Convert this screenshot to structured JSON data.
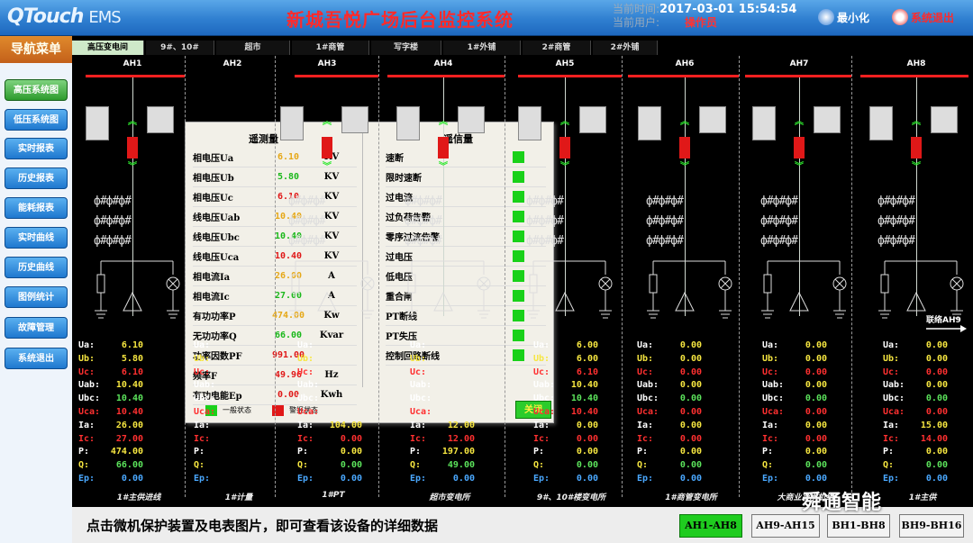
{
  "app": {
    "logo": "QTouch",
    "logo_suffix": "EMS",
    "title": "新城吾悦广场后台监控系统"
  },
  "status": {
    "time_label": "当前时间:",
    "time_value": "2017-03-01 15:54:54",
    "user_label": "当前用户:",
    "user_value": "操作员"
  },
  "header_buttons": {
    "minimize": "最小化",
    "exit": "系统退出"
  },
  "nav": {
    "title": "导航菜单",
    "items": [
      "高压系统图",
      "低压系统图",
      "实时报表",
      "历史报表",
      "能耗报表",
      "实时曲线",
      "历史曲线",
      "图例统计",
      "故障管理",
      "系统退出"
    ],
    "active_index": 0
  },
  "tabs": {
    "items": [
      "高压变电间",
      "9#、10#",
      "超市",
      "1#商管",
      "写字楼",
      "1#外铺",
      "2#商管",
      "2#外铺"
    ],
    "active_index": 0
  },
  "columns": [
    "AH1",
    "AH2",
    "AH3",
    "AH4",
    "AH5",
    "AH6",
    "AH7",
    "AH8"
  ],
  "link_label": "联络AH9",
  "reading_keys": [
    "Ua:",
    "Ub:",
    "Uc:",
    "Uab:",
    "Ubc:",
    "Uca:",
    "Ia:",
    "Ic:",
    "P:",
    "Q:",
    "Ep:"
  ],
  "readings": [
    [
      "6.10",
      "5.80",
      "6.10",
      "10.40",
      "10.40",
      "10.40",
      "26.00",
      "27.00",
      "474.00",
      "66.00",
      "0.00"
    ],
    [
      "",
      "",
      "",
      "",
      "",
      "",
      "",
      "",
      "",
      "",
      ""
    ],
    [
      "",
      "",
      "",
      "",
      "",
      "",
      "104.00",
      "0.00",
      "0.00",
      "0.00",
      "0.00"
    ],
    [
      "",
      "",
      "",
      "",
      "",
      "",
      "12.00",
      "12.00",
      "197.00",
      "49.00",
      "0.00"
    ],
    [
      "6.00",
      "6.00",
      "6.10",
      "10.40",
      "10.40",
      "10.40",
      "0.00",
      "0.00",
      "0.00",
      "0.00",
      "0.00"
    ],
    [
      "0.00",
      "0.00",
      "0.00",
      "0.00",
      "0.00",
      "0.00",
      "0.00",
      "0.00",
      "0.00",
      "0.00",
      "0.00"
    ],
    [
      "0.00",
      "0.00",
      "0.00",
      "0.00",
      "0.00",
      "0.00",
      "0.00",
      "0.00",
      "0.00",
      "0.00",
      "0.00"
    ],
    [
      "0.00",
      "0.00",
      "0.00",
      "0.00",
      "0.00",
      "0.00",
      "15.00",
      "14.00",
      "0.00",
      "0.00",
      "0.00"
    ]
  ],
  "column_names": [
    "1#主供进线",
    "1#计量",
    "1#PT",
    "超市变电所",
    "9#、10#楼变电所",
    "1#商管变电所",
    "大商业冷水机组",
    "1#主供"
  ],
  "ct_symbol": "ф#ф#ф#",
  "popup": {
    "left_title": "遥测量",
    "right_title": "遥信量",
    "measurements": [
      {
        "label": "相电压Ua",
        "value": "6.10",
        "unit": "KV",
        "color": "#e6a817"
      },
      {
        "label": "相电压Ub",
        "value": "5.80",
        "unit": "KV",
        "color": "#1ab81a"
      },
      {
        "label": "相电压Uc",
        "value": "6.10",
        "unit": "KV",
        "color": "#e01818"
      },
      {
        "label": "线电压Uab",
        "value": "10.40",
        "unit": "KV",
        "color": "#e6a817"
      },
      {
        "label": "线电压Ubc",
        "value": "10.40",
        "unit": "KV",
        "color": "#1ab81a"
      },
      {
        "label": "线电压Uca",
        "value": "10.40",
        "unit": "KV",
        "color": "#e01818"
      },
      {
        "label": "相电流Ia",
        "value": "26.00",
        "unit": "A",
        "color": "#e6a817"
      },
      {
        "label": "相电流Ic",
        "value": "27.00",
        "unit": "A",
        "color": "#1ab81a"
      },
      {
        "label": "有功功率P",
        "value": "474.00",
        "unit": "Kw",
        "color": "#e6a817"
      },
      {
        "label": "无功功率Q",
        "value": "66.00",
        "unit": "Kvar",
        "color": "#1ab81a"
      },
      {
        "label": "功率因数PF",
        "value": "991.00",
        "unit": "",
        "color": "#e01818"
      },
      {
        "label": "频率F",
        "value": "49.96",
        "unit": "Hz",
        "color": "#e01818"
      },
      {
        "label": "有功电能Ep",
        "value": "0.00",
        "unit": "Kwh",
        "color": "#e01818"
      }
    ],
    "signals": [
      "速断",
      "限时速断",
      "过电流",
      "过负荷告警",
      "零序过流告警",
      "过电压",
      "低电压",
      "重合闸",
      "PT断线",
      "PT失压",
      "控制回路断线"
    ],
    "legend_normal": "一般状态",
    "legend_fault": "警报状态",
    "colors": {
      "normal": "#19d119",
      "fault": "#e01818"
    },
    "close": "关闭"
  },
  "footer": {
    "hint": "点击微机保护装置及电表图片，即可查看该设备的详细数据",
    "pages": [
      "AH1-AH8",
      "AH9-AH15",
      "BH1-BH8",
      "BH9-BH16"
    ],
    "active_index": 0
  },
  "watermark": "舜通智能"
}
